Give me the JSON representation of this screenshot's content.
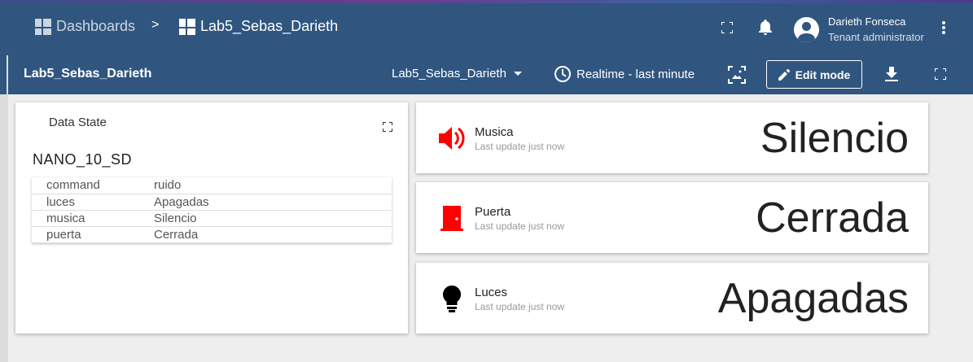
{
  "topbar": {
    "breadcrumb": [
      {
        "label": "Dashboards",
        "icon": "dashboards-icon"
      },
      {
        "label": "Lab5_Sebas_Darieth",
        "icon": "dashboard-icon"
      }
    ],
    "separator": ">",
    "user": {
      "name": "Darieth Fonseca",
      "role": "Tenant administrator"
    },
    "icons": [
      "fullscreen-icon",
      "notifications-icon",
      "more-vert-icon"
    ]
  },
  "subbar": {
    "title": "Lab5_Sebas_Darieth",
    "dashboard_select": "Lab5_Sebas_Darieth",
    "timewindow": "Realtime - last minute",
    "edit_label": "Edit mode"
  },
  "data_state": {
    "title": "Data State",
    "device": "NANO_10_SD",
    "rows": [
      {
        "key": "command",
        "value": "ruido"
      },
      {
        "key": "luces",
        "value": "Apagadas"
      },
      {
        "key": "musica",
        "value": "Silencio"
      },
      {
        "key": "puerta",
        "value": "Cerrada"
      }
    ]
  },
  "value_cards": [
    {
      "label": "Musica",
      "sub": "Last update just now",
      "value": "Silencio",
      "icon": "volume-up-icon",
      "icon_color": "#ff0000"
    },
    {
      "label": "Puerta",
      "sub": "Last update just now",
      "value": "Cerrada",
      "icon": "door-icon",
      "icon_color": "#ff0000"
    },
    {
      "label": "Luces",
      "sub": "Last update just now",
      "value": "Apagadas",
      "icon": "lightbulb-icon",
      "icon_color": "#000000"
    }
  ],
  "colors": {
    "primary": "#305680",
    "background": "#eeeeee"
  }
}
